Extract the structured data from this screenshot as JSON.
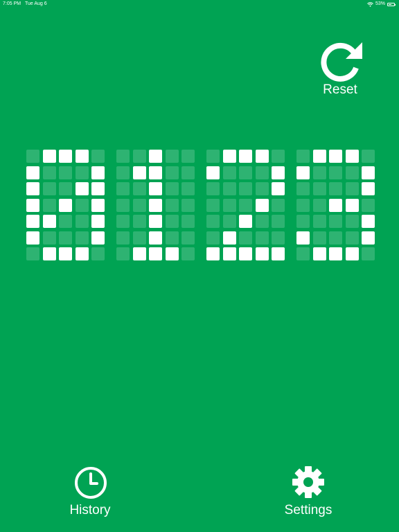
{
  "status_bar": {
    "time": "7:05 PM",
    "date": "Tue Aug 6",
    "battery": "53%",
    "battery_level": 0.53
  },
  "reset": {
    "label": "Reset",
    "icon": "refresh-icon"
  },
  "nav": {
    "history": {
      "label": "History",
      "icon": "clock-icon"
    },
    "settings": {
      "label": "Settings",
      "icon": "gear-icon"
    }
  },
  "display": {
    "value": "0123",
    "digits": [
      [
        "01110",
        "10001",
        "10011",
        "10101",
        "11001",
        "10001",
        "01110"
      ],
      [
        "00100",
        "01100",
        "00100",
        "00100",
        "00100",
        "00100",
        "01110"
      ],
      [
        "01110",
        "10001",
        "00001",
        "00010",
        "00100",
        "01000",
        "11111"
      ],
      [
        "01110",
        "10001",
        "00001",
        "00110",
        "00001",
        "10001",
        "01110"
      ]
    ]
  },
  "colors": {
    "background": "#00a353",
    "pixel_on": "#ffffff",
    "pixel_off": "rgba(255,255,255,0.18)"
  }
}
